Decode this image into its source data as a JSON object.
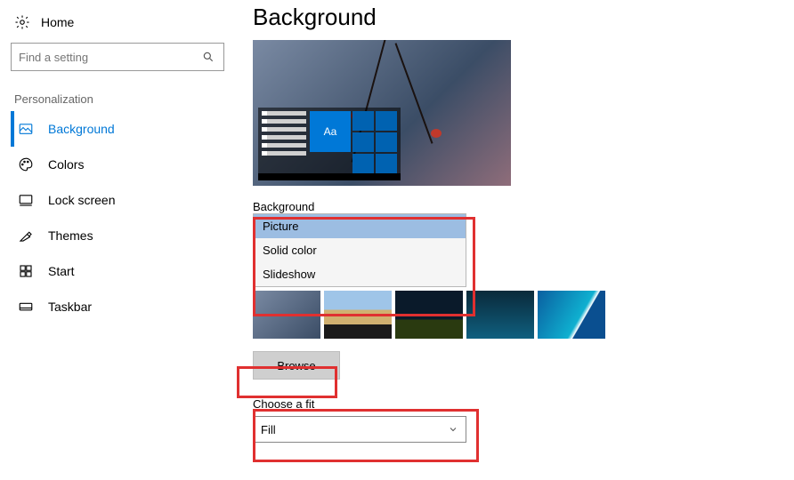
{
  "sidebar": {
    "home": "Home",
    "search_placeholder": "Find a setting",
    "section": "Personalization",
    "items": [
      {
        "icon": "image-icon",
        "label": "Background",
        "active": true
      },
      {
        "icon": "palette-icon",
        "label": "Colors"
      },
      {
        "icon": "lock-screen-icon",
        "label": "Lock screen"
      },
      {
        "icon": "themes-icon",
        "label": "Themes"
      },
      {
        "icon": "start-icon",
        "label": "Start"
      },
      {
        "icon": "taskbar-icon",
        "label": "Taskbar"
      }
    ]
  },
  "main": {
    "title": "Background",
    "preview_tile_text": "Aa",
    "background_dropdown": {
      "label": "Background",
      "options": [
        "Picture",
        "Solid color",
        "Slideshow"
      ],
      "selected": "Picture"
    },
    "browse_button": "Browse",
    "fit": {
      "label": "Choose a fit",
      "value": "Fill"
    }
  }
}
